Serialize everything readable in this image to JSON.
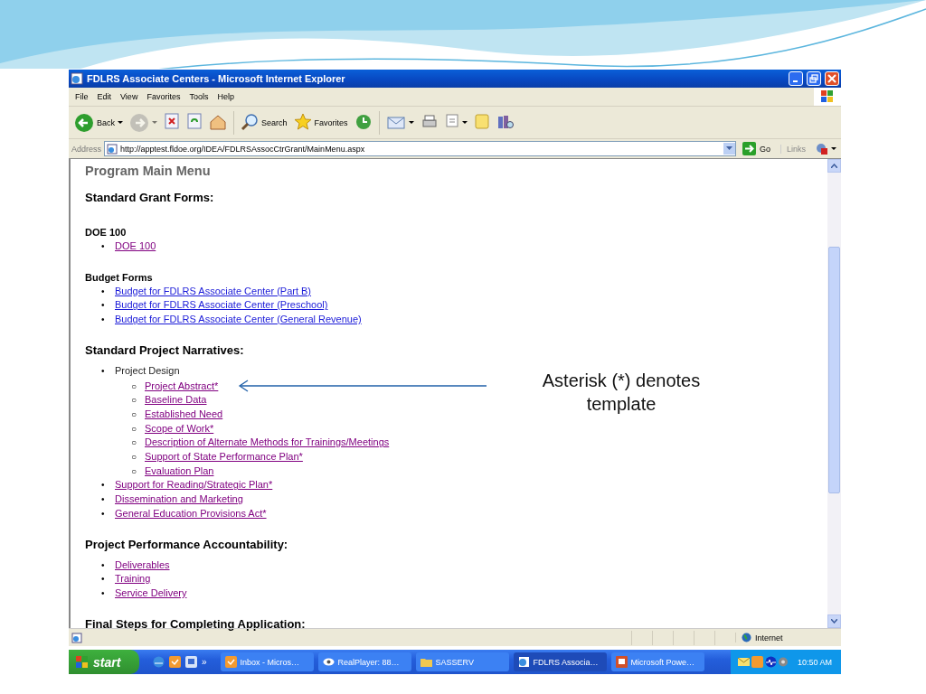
{
  "slide": {
    "callout": "Asterisk (*) denotes template"
  },
  "window": {
    "title": "FDLRS Associate Centers - Microsoft Internet Explorer"
  },
  "menu": [
    "File",
    "Edit",
    "View",
    "Favorites",
    "Tools",
    "Help"
  ],
  "toolbar": [
    {
      "kind": "back",
      "label": "Back",
      "dropdown": true,
      "disabled": false
    },
    {
      "kind": "forward",
      "dropdown": true,
      "disabled": true
    },
    {
      "kind": "stop",
      "dropdown": false,
      "disabled": false
    },
    {
      "kind": "refresh",
      "dropdown": false,
      "disabled": false
    },
    {
      "kind": "home",
      "dropdown": false,
      "disabled": false
    },
    {
      "kind": "search",
      "label": "Search",
      "dropdown": false,
      "disabled": false
    },
    {
      "kind": "favorites",
      "label": "Favorites",
      "dropdown": false,
      "disabled": false
    },
    {
      "kind": "history",
      "dropdown": false,
      "disabled": false
    },
    {
      "kind": "mail",
      "dropdown": true,
      "disabled": false
    },
    {
      "kind": "print",
      "dropdown": false,
      "disabled": false
    },
    {
      "kind": "edit",
      "dropdown": true,
      "disabled": false
    },
    {
      "kind": "note",
      "dropdown": false,
      "disabled": false
    },
    {
      "kind": "research",
      "dropdown": false,
      "disabled": false
    }
  ],
  "address": {
    "label": "Address",
    "url": "http://apptest.fldoe.org/IDEA/FDLRSAssocCtrGrant/MainMenu.aspx",
    "go": "Go",
    "links": "Links"
  },
  "page": {
    "title": "Program Main Menu",
    "blocks": [
      {
        "kind": "heading",
        "text": "Standard Grant Forms:"
      },
      {
        "kind": "subheading",
        "text": "DOE 100"
      },
      {
        "kind": "list",
        "items": [
          {
            "kind": "link",
            "marker": "•",
            "text": "DOE 100",
            "visited": true
          }
        ]
      },
      {
        "kind": "subheading",
        "text": "Budget Forms"
      },
      {
        "kind": "list",
        "items": [
          {
            "kind": "link",
            "marker": "•",
            "text": "Budget for FDLRS Associate Center (Part B)",
            "visited": false
          },
          {
            "kind": "link",
            "marker": "•",
            "text": "Budget for FDLRS Associate Center (Preschool)",
            "visited": false
          },
          {
            "kind": "link",
            "marker": "•",
            "text": "Budget for FDLRS Associate Center (General Revenue)",
            "visited": false
          }
        ]
      },
      {
        "kind": "heading",
        "text": "Standard Project Narratives:"
      },
      {
        "kind": "list",
        "items": [
          {
            "kind": "text",
            "marker": "•",
            "text": "Project Design",
            "children": [
              {
                "kind": "link",
                "marker": "○",
                "text": "Project Abstract*",
                "visited": true
              },
              {
                "kind": "link",
                "marker": "○",
                "text": "Baseline Data",
                "visited": true
              },
              {
                "kind": "link",
                "marker": "○",
                "text": "Established Need",
                "visited": true
              },
              {
                "kind": "link",
                "marker": "○",
                "text": "Scope of Work*",
                "visited": true
              },
              {
                "kind": "link",
                "marker": "○",
                "text": "Description of Alternate Methods for Trainings/Meetings",
                "visited": true
              },
              {
                "kind": "link",
                "marker": "○",
                "text": "Support of State Performance Plan*",
                "visited": true
              },
              {
                "kind": "link",
                "marker": "○",
                "text": "Evaluation Plan",
                "visited": true
              }
            ]
          },
          {
            "kind": "link",
            "marker": "•",
            "text": "Support for Reading/Strategic Plan*",
            "visited": true
          },
          {
            "kind": "link",
            "marker": "•",
            "text": "Dissemination and Marketing",
            "visited": true
          },
          {
            "kind": "link",
            "marker": "•",
            "text": "General Education Provisions Act*",
            "visited": true
          }
        ]
      },
      {
        "kind": "heading",
        "text": "Project Performance Accountability:"
      },
      {
        "kind": "list",
        "items": [
          {
            "kind": "link",
            "marker": "•",
            "text": "Deliverables",
            "visited": true
          },
          {
            "kind": "link",
            "marker": "•",
            "text": "Training",
            "visited": true
          },
          {
            "kind": "link",
            "marker": "•",
            "text": "Service Delivery",
            "visited": true
          }
        ]
      },
      {
        "kind": "heading",
        "text": "Final Steps for Completing Application:"
      }
    ]
  },
  "status_bar": {
    "zone": "Internet"
  },
  "taskbar": {
    "start": "start",
    "chevron": "»",
    "tasks": [
      {
        "kind": "mail",
        "label": "Inbox - Micros…",
        "selected": false
      },
      {
        "kind": "player",
        "label": "RealPlayer: 88…",
        "selected": false
      },
      {
        "kind": "folder",
        "label": "SASSERV",
        "selected": false
      },
      {
        "kind": "browser",
        "label": "FDLRS Associa…",
        "selected": true
      },
      {
        "kind": "slides",
        "label": "Microsoft Powe…",
        "selected": false
      }
    ],
    "clock": "10:50 AM"
  }
}
